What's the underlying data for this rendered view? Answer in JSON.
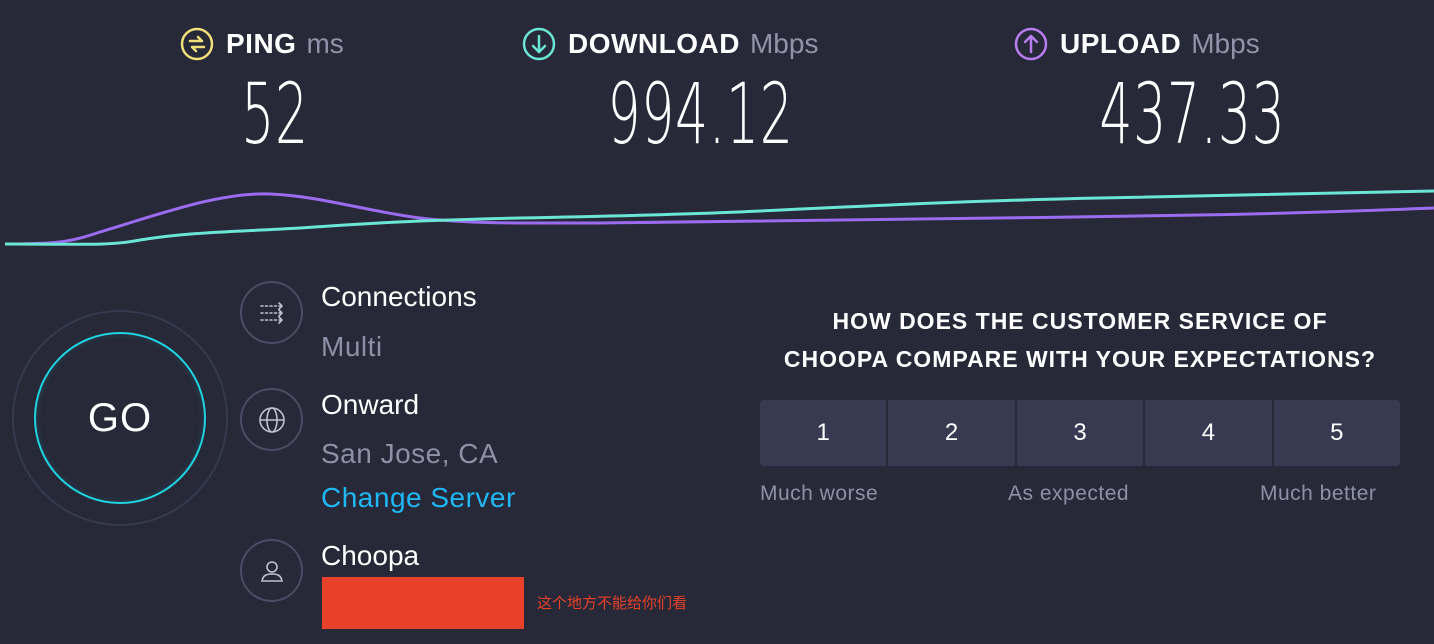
{
  "metrics": {
    "ping": {
      "label": "PING",
      "unit": "ms",
      "value": "52",
      "color": "#f0e07a",
      "icon": "ping-icon"
    },
    "download": {
      "label": "DOWNLOAD",
      "unit": "Mbps",
      "value": "994.12",
      "color": "#6be6d4",
      "icon": "download-arrow-icon"
    },
    "upload": {
      "label": "UPLOAD",
      "unit": "Mbps",
      "value": "437.33",
      "color": "#b87df0",
      "icon": "upload-arrow-icon"
    }
  },
  "go_button": {
    "label": "GO",
    "color": "#1fd3e0"
  },
  "connections": {
    "title": "Connections",
    "value": "Multi",
    "icon": "connections-icon"
  },
  "server": {
    "title": "Onward",
    "location": "San Jose, CA",
    "change_link": "Change Server",
    "icon": "globe-icon"
  },
  "provider": {
    "title": "Choopa",
    "icon": "user-icon"
  },
  "redaction_note": "这个地方不能给你们看",
  "survey": {
    "question_line1": "HOW DOES THE CUSTOMER SERVICE OF",
    "question_line2": "CHOOPA COMPARE WITH YOUR EXPECTATIONS?",
    "options": [
      "1",
      "2",
      "3",
      "4",
      "5"
    ],
    "scale_low": "Much worse",
    "scale_mid": "As expected",
    "scale_high": "Much better"
  },
  "colors": {
    "background": "#272838",
    "download_line": "#6be6d4",
    "upload_line": "#9b6cf0",
    "link": "#1fb8f5",
    "redaction": "#e8412a"
  }
}
